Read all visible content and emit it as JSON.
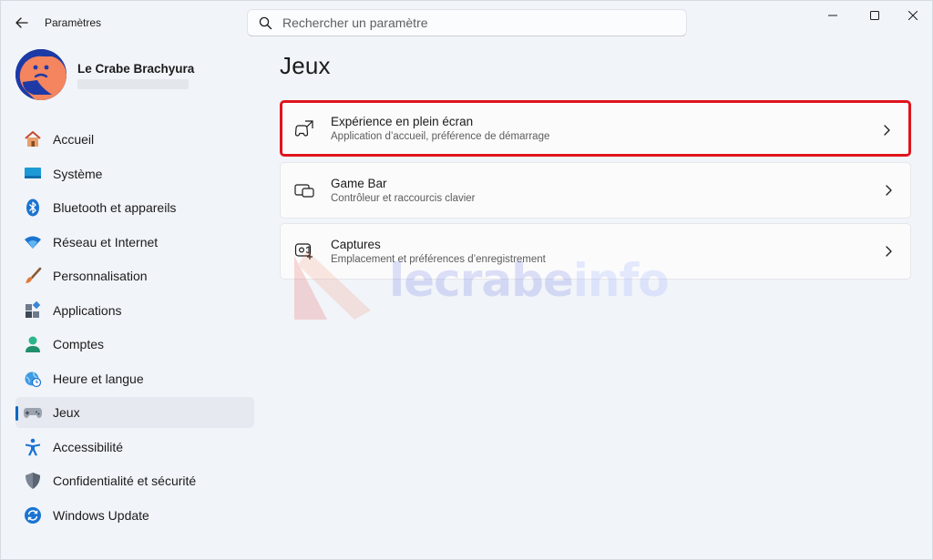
{
  "window": {
    "title": "Paramètres"
  },
  "search": {
    "placeholder": "Rechercher un paramètre"
  },
  "profile": {
    "name": "Le Crabe Brachyura"
  },
  "sidebar": {
    "items": [
      {
        "label": "Accueil",
        "icon": "home-icon",
        "active": false
      },
      {
        "label": "Système",
        "icon": "display-icon",
        "active": false
      },
      {
        "label": "Bluetooth et appareils",
        "icon": "bluetooth-icon",
        "active": false
      },
      {
        "label": "Réseau et Internet",
        "icon": "wifi-icon",
        "active": false
      },
      {
        "label": "Personnalisation",
        "icon": "brush-icon",
        "active": false
      },
      {
        "label": "Applications",
        "icon": "apps-icon",
        "active": false
      },
      {
        "label": "Comptes",
        "icon": "person-icon",
        "active": false
      },
      {
        "label": "Heure et langue",
        "icon": "globe-clock-icon",
        "active": false
      },
      {
        "label": "Jeux",
        "icon": "gamepad-icon",
        "active": true
      },
      {
        "label": "Accessibilité",
        "icon": "accessibility-icon",
        "active": false
      },
      {
        "label": "Confidentialité et sécurité",
        "icon": "shield-icon",
        "active": false
      },
      {
        "label": "Windows Update",
        "icon": "update-icon",
        "active": false
      }
    ]
  },
  "main": {
    "title": "Jeux",
    "cards": [
      {
        "title": "Expérience en plein écran",
        "subtitle": "Application d’accueil, préférence de démarrage",
        "icon": "fullscreen-gamepad-icon",
        "highlighted": true
      },
      {
        "title": "Game Bar",
        "subtitle": "Contrôleur et raccourcis clavier",
        "icon": "game-bar-icon",
        "highlighted": false
      },
      {
        "title": "Captures",
        "subtitle": "Emplacement et préférences d’enregistrement",
        "icon": "capture-icon",
        "highlighted": false
      }
    ]
  },
  "watermark": {
    "text_main": "lecrabe",
    "text_accent": "info"
  },
  "colors": {
    "accent": "#0067c0",
    "highlight_border": "#e0141c"
  }
}
